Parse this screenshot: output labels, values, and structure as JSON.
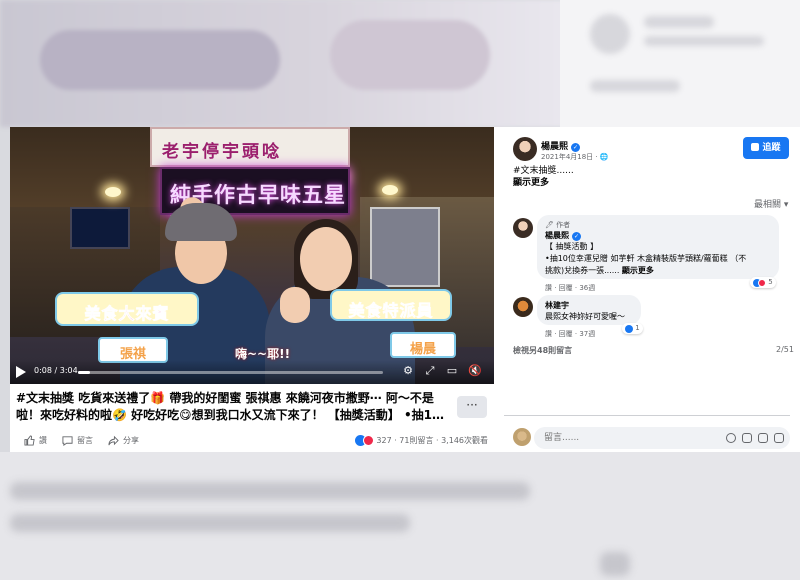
{
  "video": {
    "sign_top": "老宇停宇頭唸",
    "sign_neon": "純手作古早味五星蔥",
    "caption_left": "美食大來賓",
    "caption_right": "美食特派員",
    "name_left": "張祺",
    "name_right": "楊晨",
    "shout": "嗨~~耶!!",
    "time": "0:08 / 3:04",
    "progress": 0.04
  },
  "post": {
    "text": "#文末抽獎 吃貨來送禮了🎁 帶我的好閨蜜 張祺惠 來饒河夜市撒野⋯ 阿～不是啦！來吃好料的啦🤣 好吃好吃😋想到我口水又流下來了！ 【抽獎活動】 •抽1…",
    "more": "···",
    "actions": {
      "like": "讚",
      "comment": "留言",
      "share": "分享"
    },
    "stats": "327 · 71則留言 · 3,146次觀看"
  },
  "side": {
    "page_name": "楊晨熙",
    "date": "2021年4月18日 · ",
    "follow": "追蹤",
    "caption_line1": "#文末抽獎......",
    "see_more": "顯示更多",
    "sort": "最相關 ▾",
    "comments": [
      {
        "tag": "🖊 作者",
        "author": "楊晨熙",
        "line1": "【 抽獎活動 】",
        "line2": "•抽10位幸運兒贈 如芋軒 木盒精裝版芋頭糕/蘿蔔糕 （不",
        "line3": "挑款)兌換券一張...... ",
        "see_more": "顯示更多",
        "meta": "讚 · 回覆 · 36週",
        "reactions": "5"
      },
      {
        "author": "林建宇",
        "text": "晨熙女神妳好可愛喔～",
        "meta": "讚 · 回覆 · 37週",
        "reactions": "1"
      }
    ],
    "view_more": "檢視另48則留言",
    "counter": "2/51",
    "input_placeholder": "留言......"
  },
  "colors": {
    "accent": "#1877f2",
    "love": "#f0284a"
  }
}
